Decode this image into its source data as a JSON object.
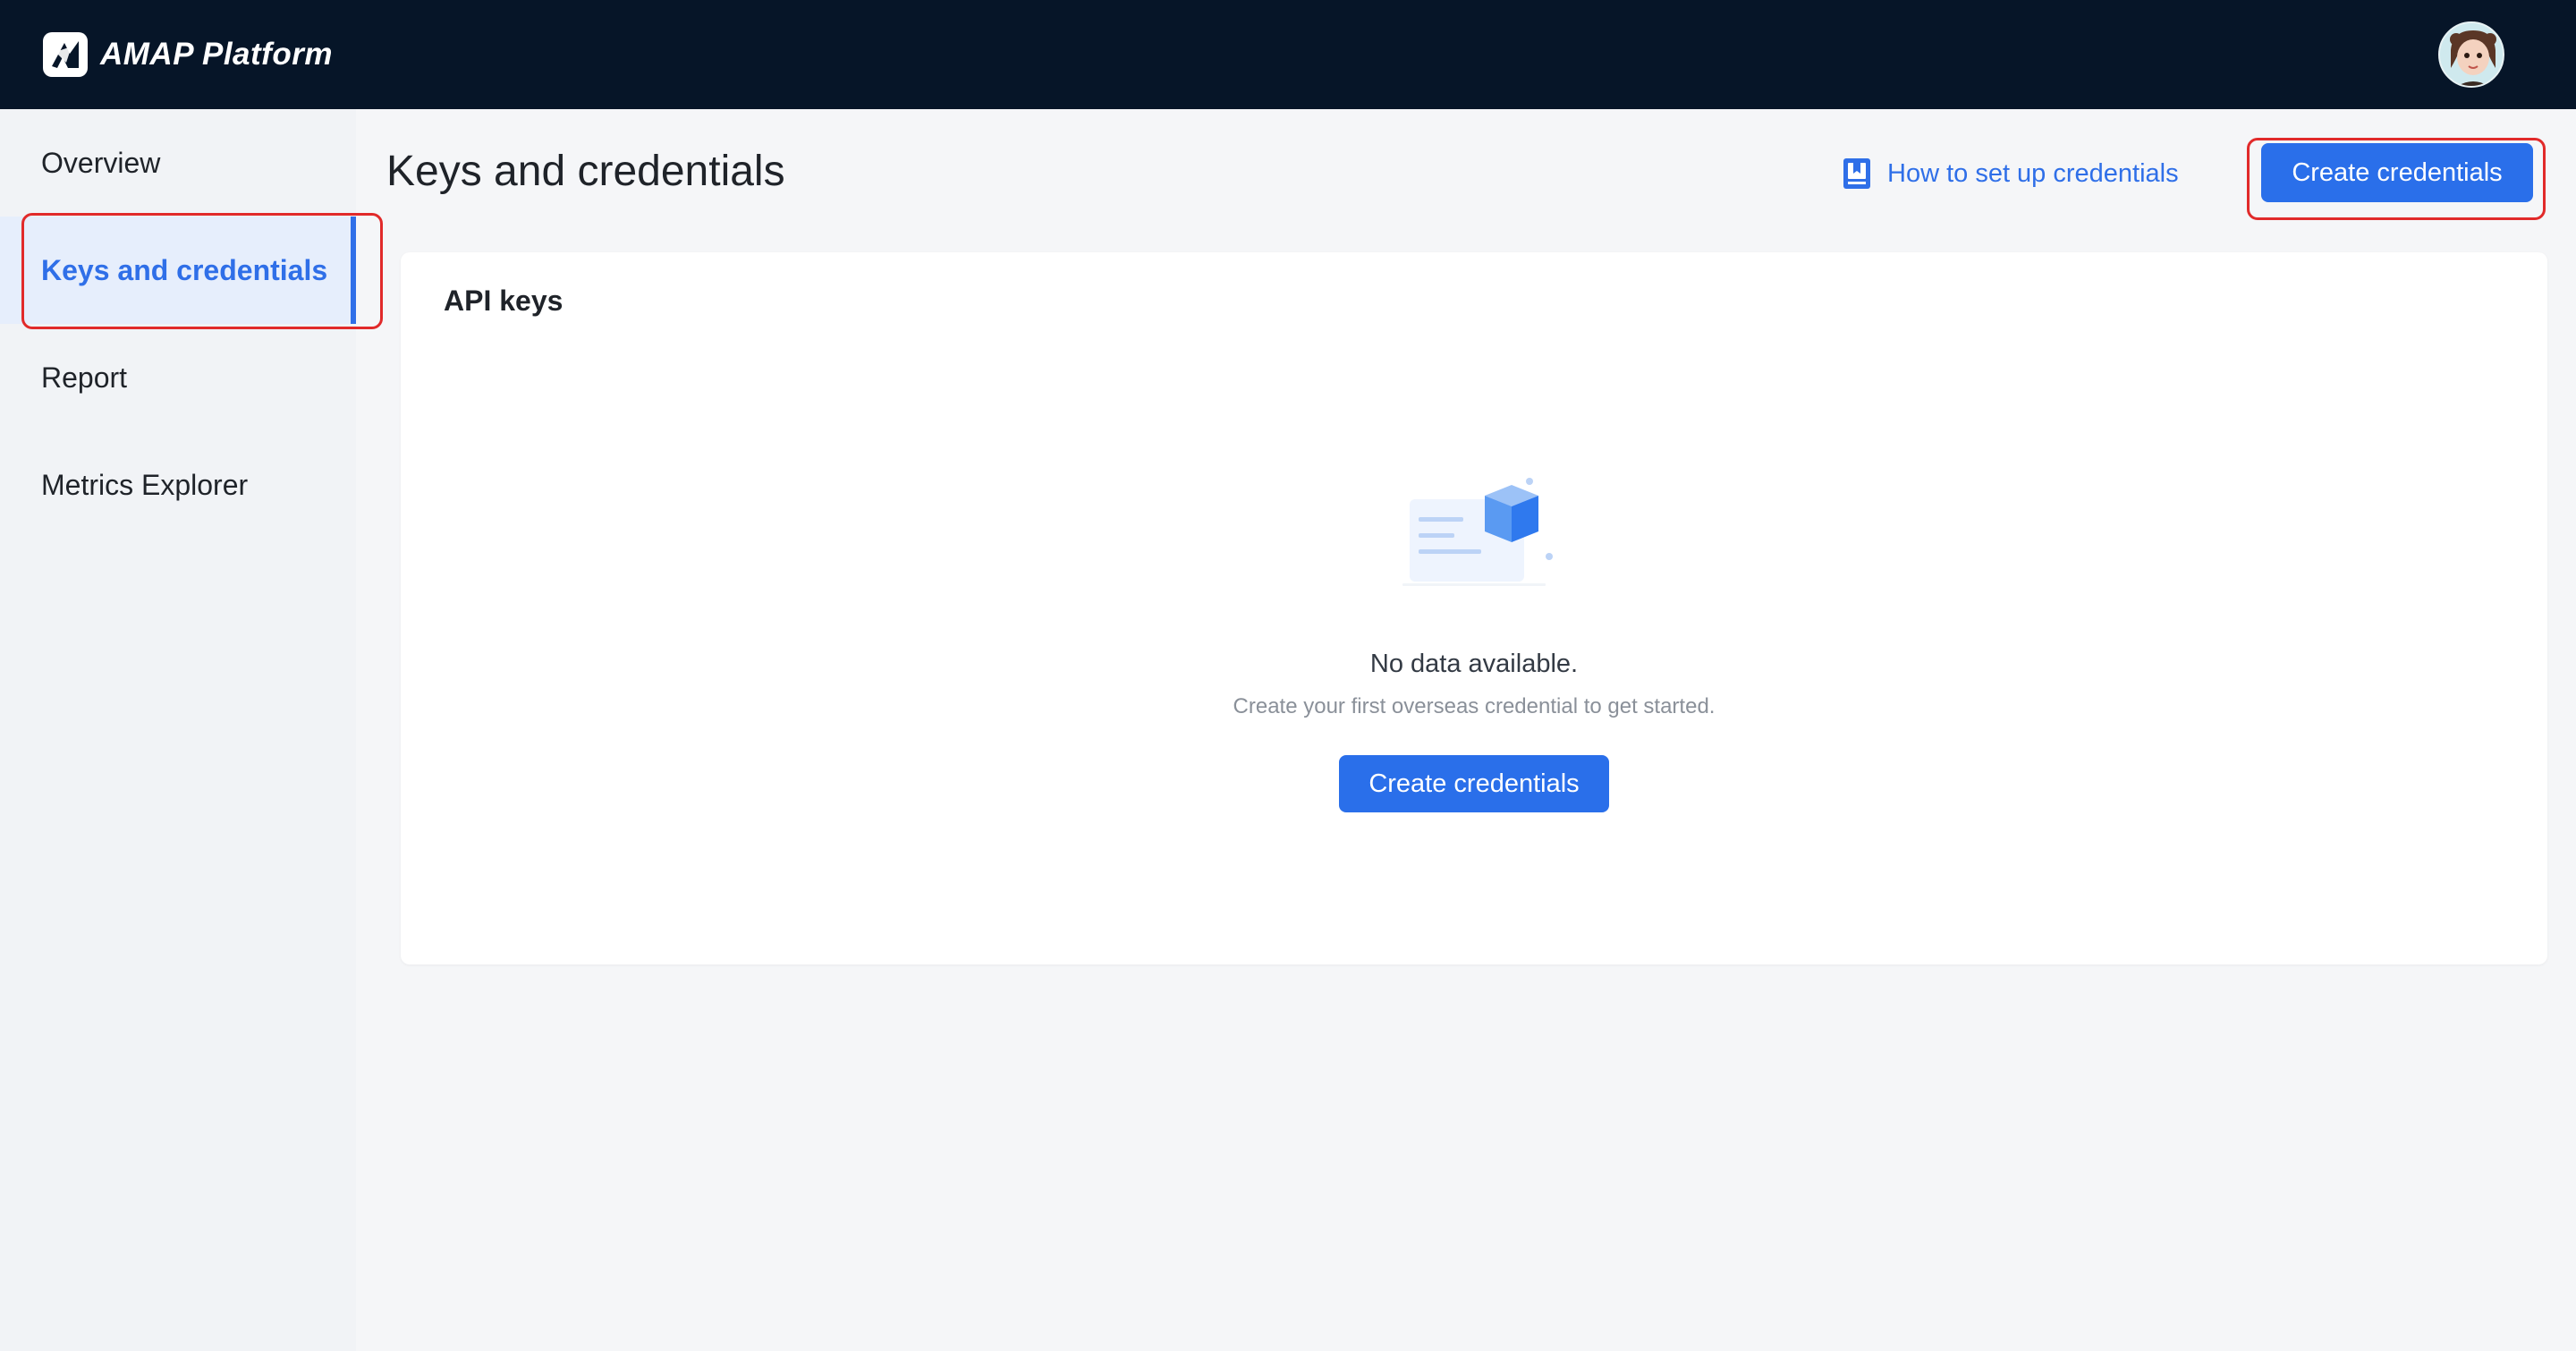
{
  "app": {
    "name": "AMAP Platform"
  },
  "sidebar": {
    "items": [
      {
        "label": "Overview"
      },
      {
        "label": "Keys and credentials"
      },
      {
        "label": "Report"
      },
      {
        "label": "Metrics Explorer"
      }
    ],
    "active_index": 1
  },
  "header": {
    "title": "Keys and credentials",
    "help_link": "How to set up credentials",
    "primary_button": "Create credentials"
  },
  "card": {
    "title": "API keys",
    "empty_title": "No data available.",
    "empty_subtitle": "Create your first overseas credential to get started.",
    "empty_button": "Create credentials"
  },
  "colors": {
    "topbar": "#061528",
    "accent": "#2a6fea",
    "highlight": "#e12a2a"
  },
  "icons": {
    "logo": "amap-logo-icon",
    "help": "book-icon",
    "empty": "empty-box-illustration",
    "avatar": "user-avatar"
  }
}
